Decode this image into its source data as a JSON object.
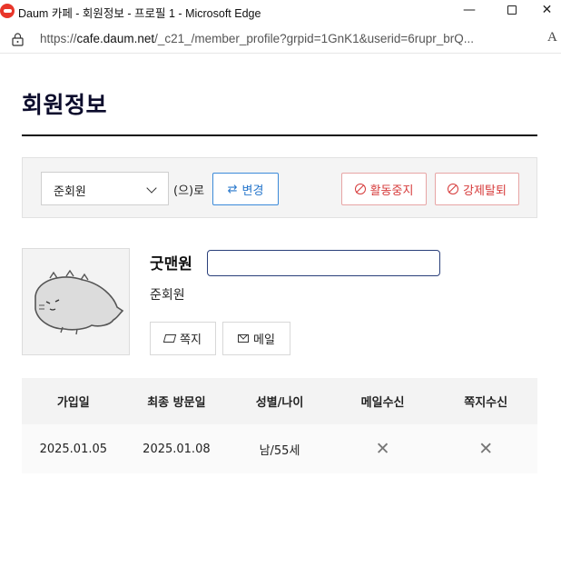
{
  "window": {
    "title": "Daum 카페 - 회원정보 - 프로필 1 - Microsoft Edge",
    "minimize_icon": "minimize-icon",
    "maximize_icon": "maximize-icon",
    "close_icon": "close-icon"
  },
  "addressbar": {
    "url_prefix": "https://",
    "url_host": "cafe.daum.net",
    "url_path": "/_c21_/member_profile?grpid=1GnK1&userid=6rupr_brQ...",
    "read_aloud_label": "A"
  },
  "page": {
    "title": "회원정보"
  },
  "toolbar": {
    "grade_selected": "준회원",
    "suffix": "(으)로",
    "change_label": "변경",
    "suspend_label": "활동중지",
    "expel_label": "강제탈퇴"
  },
  "profile": {
    "nickname": "굿맨원",
    "grade": "준회원",
    "note_label": "쪽지",
    "mail_label": "메일"
  },
  "info_table": {
    "headers": [
      "가입일",
      "최종 방문일",
      "성별/나이",
      "메일수신",
      "쪽지수신"
    ],
    "values": [
      "2025.01.05",
      "2025.01.08",
      "남/55세",
      "✕",
      "✕"
    ]
  },
  "colors": {
    "primary_blue": "#2777cc",
    "danger_red": "#d63a3a",
    "title_navy": "#0c0c2c"
  }
}
